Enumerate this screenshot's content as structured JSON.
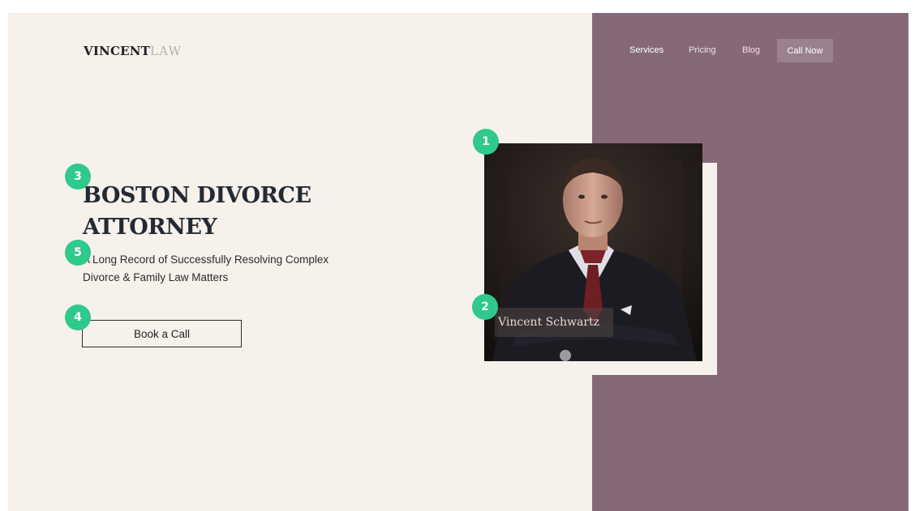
{
  "logo": {
    "strong": "VINCENT",
    "light": "LAW"
  },
  "nav": {
    "services": "Services",
    "pricing": "Pricing",
    "blog": "Blog",
    "call_now": "Call Now"
  },
  "hero": {
    "title_line1": "BOSTON DIVORCE",
    "title_line2": "ATTORNEY",
    "subtitle": "A Long Record of Successfully Resolving Complex Divorce & Family Law Matters",
    "cta": "Book a Call"
  },
  "profile": {
    "name": "Vincent Schwartz"
  },
  "annotations": {
    "b1": "1",
    "b2": "2",
    "b3": "3",
    "b4": "4",
    "b5": "5"
  },
  "colors": {
    "background": "#f6f1eb",
    "panel": "#866978",
    "accent_badge": "#2fc98a",
    "heading": "#242a33"
  }
}
